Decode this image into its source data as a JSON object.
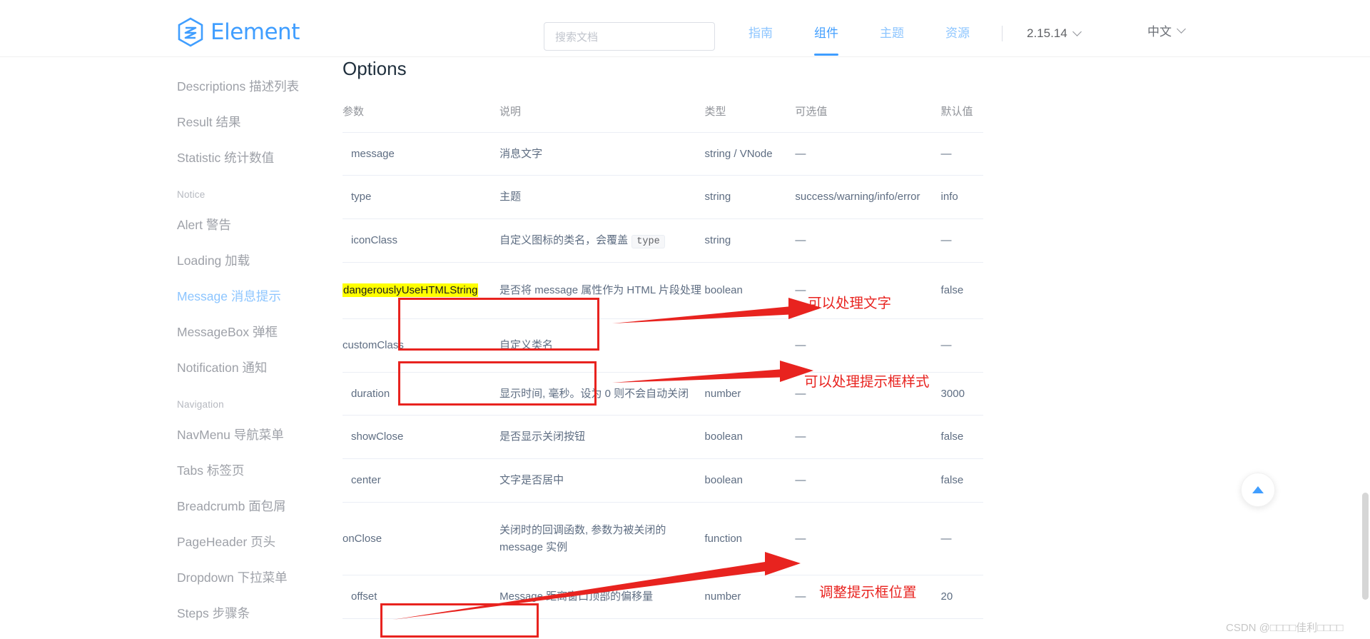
{
  "header": {
    "logo_text": "Element",
    "logo_icon": "element-hexagon-logo-icon",
    "search_placeholder": "搜索文档",
    "nav_items": [
      {
        "label": "指南",
        "active": false
      },
      {
        "label": "组件",
        "active": true
      },
      {
        "label": "主题",
        "active": false
      },
      {
        "label": "资源",
        "active": false
      }
    ],
    "version": "2.15.14",
    "language": "中文"
  },
  "sidebar": {
    "items": [
      {
        "label": "Descriptions 描述列表",
        "type": "item",
        "active": false
      },
      {
        "label": "Result 结果",
        "type": "item",
        "active": false
      },
      {
        "label": "Statistic 统计数值",
        "type": "item",
        "active": false
      },
      {
        "label": "Notice",
        "type": "group"
      },
      {
        "label": "Alert 警告",
        "type": "item",
        "active": false
      },
      {
        "label": "Loading 加载",
        "type": "item",
        "active": false
      },
      {
        "label": "Message 消息提示",
        "type": "item",
        "active": true
      },
      {
        "label": "MessageBox 弹框",
        "type": "item",
        "active": false
      },
      {
        "label": "Notification 通知",
        "type": "item",
        "active": false
      },
      {
        "label": "Navigation",
        "type": "group"
      },
      {
        "label": "NavMenu 导航菜单",
        "type": "item",
        "active": false
      },
      {
        "label": "Tabs 标签页",
        "type": "item",
        "active": false
      },
      {
        "label": "Breadcrumb 面包屑",
        "type": "item",
        "active": false
      },
      {
        "label": "PageHeader 页头",
        "type": "item",
        "active": false
      },
      {
        "label": "Dropdown 下拉菜单",
        "type": "item",
        "active": false
      },
      {
        "label": "Steps 步骤条",
        "type": "item",
        "active": false
      }
    ]
  },
  "main": {
    "title": "Options",
    "table": {
      "headers": [
        "参数",
        "说明",
        "类型",
        "可选值",
        "默认值"
      ],
      "rows": [
        {
          "param": "message",
          "desc": "消息文字",
          "desc_code": "",
          "type": "string / VNode",
          "options": "—",
          "default": "—"
        },
        {
          "param": "type",
          "desc": "主题",
          "desc_code": "",
          "type": "string",
          "options": "success/warning/info/error",
          "default": "info"
        },
        {
          "param": "iconClass",
          "desc": "自定义图标的类名，会覆盖 ",
          "desc_code": "type",
          "type": "string",
          "options": "—",
          "default": "—"
        },
        {
          "param": "dangerouslyUseHTMLString",
          "desc": "是否将 message 属性作为 HTML 片段处理",
          "desc_code": "",
          "type": "boolean",
          "options": "—",
          "default": "false",
          "highlighted": true
        },
        {
          "param": "customClass",
          "desc": "自定义类名",
          "desc_code": "",
          "type": "",
          "options": "—",
          "default": "—",
          "highlighted": true
        },
        {
          "param": "duration",
          "desc": "显示时间, 毫秒。设为 0 则不会自动关闭",
          "desc_code": "",
          "type": "number",
          "options": "—",
          "default": "3000"
        },
        {
          "param": "showClose",
          "desc": "是否显示关闭按钮",
          "desc_code": "",
          "type": "boolean",
          "options": "—",
          "default": "false"
        },
        {
          "param": "center",
          "desc": "文字是否居中",
          "desc_code": "",
          "type": "boolean",
          "options": "—",
          "default": "false"
        },
        {
          "param": "onClose",
          "desc": "关闭时的回调函数, 参数为被关闭的 message 实例",
          "desc_code": "",
          "type": "function",
          "options": "—",
          "default": "—"
        },
        {
          "param": "offset",
          "desc": "Message 距离窗口顶部的偏移量",
          "desc_code": "",
          "type": "number",
          "options": "—",
          "default": "20",
          "highlighted": true
        }
      ]
    }
  },
  "annotations": [
    {
      "text": "可以处理文字",
      "id": "anno-text-handling"
    },
    {
      "text": "可以处理提示框样式",
      "id": "anno-style-handling"
    },
    {
      "text": "调整提示框位置",
      "id": "anno-position-handling"
    }
  ],
  "back_to_top": {
    "icon": "triangle-up-icon"
  },
  "watermark": "CSDN @□□□□佳利□□□□",
  "colors": {
    "brand": "#409EFF",
    "annotation_red": "#e8231f",
    "highlight_yellow": "#ffff00",
    "text_primary": "#5e6d82",
    "text_muted": "#909399"
  }
}
